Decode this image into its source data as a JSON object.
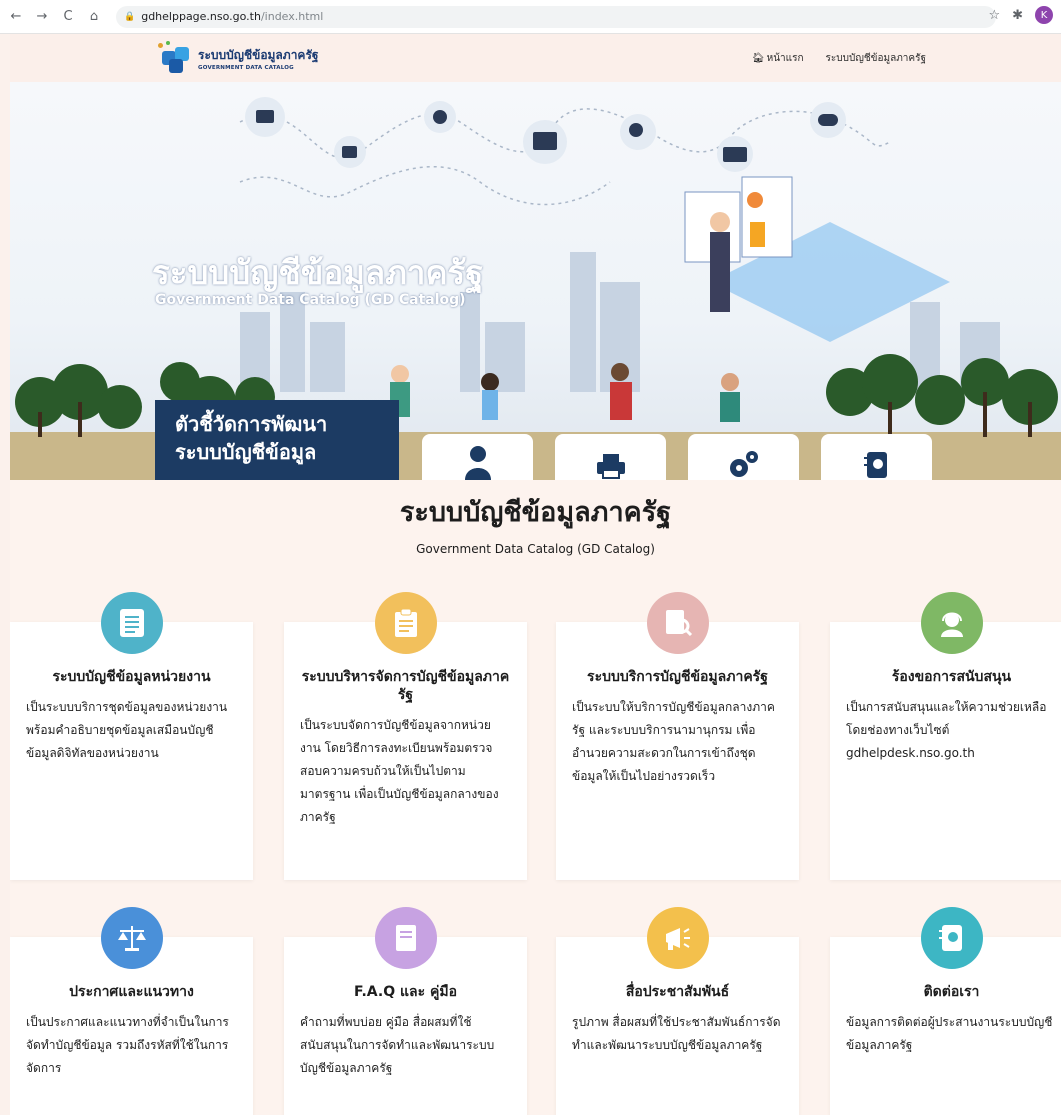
{
  "browser": {
    "url_host": "gdhelppage.nso.go.th",
    "url_path": "/index.html",
    "profile_initial": "K"
  },
  "header": {
    "logo_title": "ระบบบัญชีข้อมูลภาครัฐ",
    "logo_sub": "GOVERNMENT DATA CATALOG",
    "nav": {
      "home": "หน้าแรก",
      "catalog": "ระบบบัญชีข้อมูลภาครัฐ"
    }
  },
  "hero": {
    "title": "ระบบบัญชีข้อมูลภาครัฐ",
    "subtitle": "Government Data Catalog (GD Catalog)",
    "kpi_line1": "ตัวชี้วัดการพัฒนา",
    "kpi_line2": "ระบบบัญชีข้อมูล",
    "cards": [
      "user-icon",
      "printer-icon",
      "gears-icon",
      "contact-book-icon"
    ]
  },
  "section": {
    "title": "ระบบบัญชีข้อมูลภาครัฐ",
    "subtitle": "Government Data Catalog (GD Catalog)"
  },
  "cards": [
    {
      "icon": "document-list-icon",
      "color": "#4fb3c9",
      "title": "ระบบบัญชีข้อมูลหน่วยงาน",
      "text": "เป็นระบบบริการชุดข้อมูลของหน่วยงานพร้อมคำอธิบายชุดข้อมูลเสมือนบัญชีข้อมูลดิจิทัลของหน่วยงาน"
    },
    {
      "icon": "clipboard-icon",
      "color": "#f2c05c",
      "title": "ระบบบริหารจัดการบัญชีข้อมูลภาครัฐ",
      "text": "เป็นระบบจัดการบัญชีข้อมูลจากหน่วยงาน โดยวิธีการลงทะเบียนพร้อมตรวจสอบความครบถ้วนให้เป็นไปตามมาตรฐาน เพื่อเป็นบัญชีข้อมูลกลางของภาครัฐ"
    },
    {
      "icon": "document-search-icon",
      "color": "#e6b5b3",
      "title": "ระบบบริการบัญชีข้อมูลภาครัฐ",
      "text": "เป็นระบบให้บริการบัญชีข้อมูลกลางภาครัฐ และระบบบริการนามานุกรม เพื่ออำนวยความสะดวกในการเข้าถึงชุดข้อมูลให้เป็นไปอย่างรวดเร็ว"
    },
    {
      "icon": "support-agent-icon",
      "color": "#7fb865",
      "title": "ร้องขอการสนับสนุน",
      "text": "เป็นการสนับสนุนและให้ความช่วยเหลือ โดยช่องทางเว็บไซต์ gdhelpdesk.nso.go.th"
    },
    {
      "icon": "scales-icon",
      "color": "#4a90d9",
      "title": "ประกาศและแนวทาง",
      "text": "เป็นประกาศและแนวทางที่จำเป็นในการจัดทำบัญชีข้อมูล รวมถึงรหัสที่ใช้ในการจัดการ"
    },
    {
      "icon": "book-icon",
      "color": "#c7a2e2",
      "title": "F.A.Q และ คู่มือ",
      "text": "คำถามที่พบบ่อย คู่มือ สื่อผสมที่ใช้สนับสนุนในการจัดทำและพัฒนาระบบบัญชีข้อมูลภาครัฐ"
    },
    {
      "icon": "megaphone-icon",
      "color": "#f3c04c",
      "title": "สื่อประชาสัมพันธ์",
      "text": "รูปภาพ สื่อผสมที่ใช้ประชาสัมพันธ์การจัดทำและพัฒนาระบบบัญชีข้อมูลภาครัฐ"
    },
    {
      "icon": "contact-book-icon",
      "color": "#3db6c4",
      "title": "ติดต่อเรา",
      "text": "ข้อมูลการติดต่อผู้ประสานงานระบบบัญชีข้อมูลภาครัฐ"
    }
  ]
}
